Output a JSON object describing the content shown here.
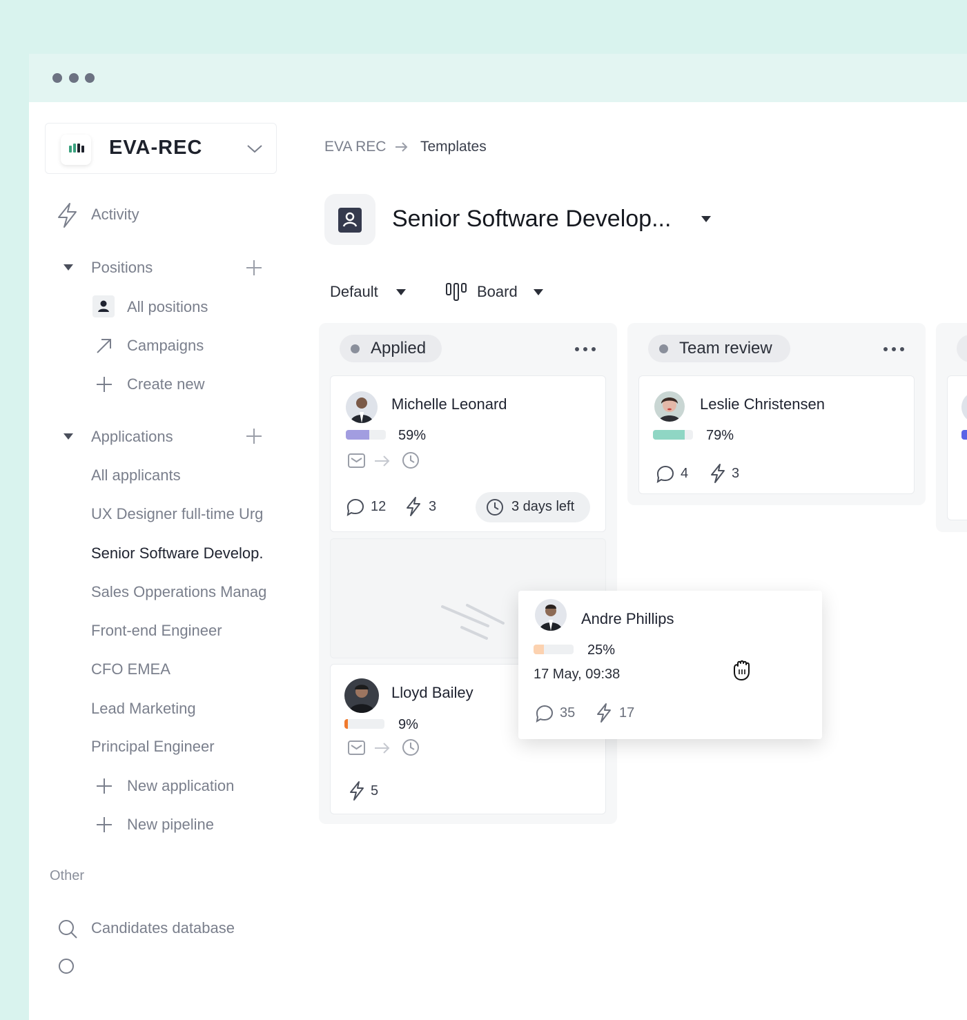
{
  "brand": {
    "name": "EVA-REC",
    "accent": "#3aa17e"
  },
  "sidebar": {
    "activity": "Activity",
    "positions": {
      "label": "Positions",
      "items": [
        "All positions",
        "Campaigns",
        "Create new"
      ]
    },
    "applications": {
      "label": "Applications",
      "items": [
        "All applicants",
        "UX Designer full-time Urg",
        "Senior Software Develop.",
        "Sales Opperations Manag",
        "Front-end Engineer",
        "CFO EMEA",
        "Lead Marketing",
        "Principal Engineer"
      ],
      "new_application": "New application",
      "new_pipeline": "New pipeline"
    },
    "other": {
      "label": "Other",
      "candidates_database": "Candidates database"
    }
  },
  "breadcrumb": {
    "root": "EVA REC",
    "current": "Templates"
  },
  "position_title": "Senior Software Develop...",
  "views": {
    "filter": "Default",
    "layout": "Board"
  },
  "columns": [
    {
      "label": "Applied",
      "dot_color": "#8a8f9b"
    },
    {
      "label": "Team review",
      "dot_color": "#8a8f9b"
    }
  ],
  "cards": {
    "michelle": {
      "name": "Michelle Leonard",
      "progress": 59,
      "progress_label": "59%",
      "color": "#a29de0",
      "comments": "12",
      "actions": "3",
      "deadline": "3 days left"
    },
    "leslie": {
      "name": "Leslie Christensen",
      "progress": 79,
      "progress_label": "79%",
      "color": "#8fd6c4",
      "comments": "4",
      "actions": "3"
    },
    "lloyd": {
      "name": "Lloyd Bailey",
      "progress": 9,
      "progress_label": "9%",
      "color": "#f07a2e",
      "actions": "5"
    },
    "andre": {
      "name": "Andre Phillips",
      "progress": 25,
      "progress_label": "25%",
      "color": "#fcd2b0",
      "date": "17 May, 09:38",
      "comments": "35",
      "actions": "17"
    }
  }
}
